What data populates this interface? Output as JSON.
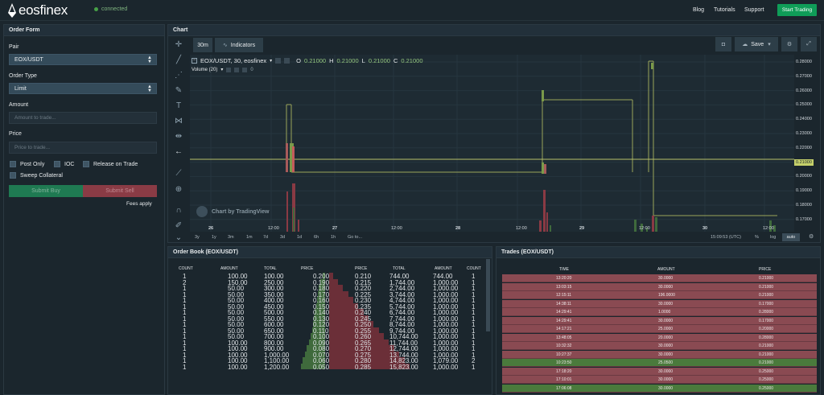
{
  "header": {
    "logo_text": "eosfinex",
    "status": "connected",
    "nav": [
      "Blog",
      "Tutorials",
      "Support"
    ],
    "cta": "Start Trading"
  },
  "order_form": {
    "title": "Order Form",
    "pair_label": "Pair",
    "pair_value": "EOX/USDT",
    "order_type_label": "Order Type",
    "order_type_value": "Limit",
    "amount_label": "Amount",
    "amount_placeholder": "Amount to trade...",
    "price_label": "Price",
    "price_placeholder": "Price to trade...",
    "post_only": "Post Only",
    "ioc": "IOC",
    "release": "Release on Trade",
    "sweep": "Sweep Collateral",
    "buy": "Submit Buy",
    "sell": "Submit Sell",
    "fees": "Fees apply"
  },
  "chart": {
    "title": "Chart",
    "interval": "30m",
    "indicators": "Indicators",
    "save": "Save",
    "symbol": "EOX/USDT, 30, eosfinex",
    "ohlc": {
      "O": "0.21000",
      "H": "0.21000",
      "L": "0.21000",
      "C": "0.21000"
    },
    "volume": "Volume (20)",
    "volume_value": "0",
    "watermark": "Chart by TradingView",
    "price_ticks": [
      "0.28000",
      "0.27000",
      "0.26000",
      "0.25000",
      "0.24000",
      "0.23000",
      "0.22000",
      "0.21000",
      "0.20000",
      "0.19000",
      "0.18000",
      "0.17000"
    ],
    "current_price": "0.21000",
    "time_ticks": [
      "26",
      "12:00",
      "27",
      "12:00",
      "28",
      "12:00",
      "29",
      "12:00",
      "30",
      "12:00"
    ],
    "ranges": [
      "3y",
      "1y",
      "3m",
      "1m",
      "7d",
      "3d",
      "1d",
      "6h",
      "1h",
      "Go to..."
    ],
    "clock": "15:09:53 (UTC)",
    "pct": "%",
    "log": "log",
    "auto": "auto"
  },
  "order_book": {
    "title": "Order Book (EOX/USDT)",
    "headers": [
      "COUNT",
      "AMOUNT",
      "TOTAL",
      "PRICE",
      "PRICE",
      "TOTAL",
      "AMOUNT",
      "COUNT"
    ],
    "bids": [
      [
        "1",
        "100.00",
        "100.00",
        "0.200"
      ],
      [
        "2",
        "150.00",
        "250.00",
        "0.190"
      ],
      [
        "1",
        "50.00",
        "300.00",
        "0.180"
      ],
      [
        "1",
        "50.00",
        "350.00",
        "0.170"
      ],
      [
        "1",
        "50.00",
        "400.00",
        "0.160"
      ],
      [
        "1",
        "50.00",
        "450.00",
        "0.150"
      ],
      [
        "1",
        "50.00",
        "500.00",
        "0.140"
      ],
      [
        "1",
        "50.00",
        "550.00",
        "0.130"
      ],
      [
        "1",
        "50.00",
        "600.00",
        "0.120"
      ],
      [
        "1",
        "50.00",
        "650.00",
        "0.110"
      ],
      [
        "1",
        "50.00",
        "700.00",
        "0.100"
      ],
      [
        "1",
        "100.00",
        "800.00",
        "0.090"
      ],
      [
        "1",
        "100.00",
        "900.00",
        "0.080"
      ],
      [
        "1",
        "100.00",
        "1,000.00",
        "0.070"
      ],
      [
        "1",
        "100.00",
        "1,100.00",
        "0.060"
      ],
      [
        "1",
        "100.00",
        "1,200.00",
        "0.050"
      ]
    ],
    "asks": [
      [
        "0.210",
        "744.00",
        "744.00",
        "1"
      ],
      [
        "0.215",
        "1,744.00",
        "1,000.00",
        "1"
      ],
      [
        "0.220",
        "2,744.00",
        "1,000.00",
        "1"
      ],
      [
        "0.225",
        "3,744.00",
        "1,000.00",
        "1"
      ],
      [
        "0.230",
        "4,744.00",
        "1,000.00",
        "1"
      ],
      [
        "0.235",
        "5,744.00",
        "1,000.00",
        "1"
      ],
      [
        "0.240",
        "6,744.00",
        "1,000.00",
        "1"
      ],
      [
        "0.245",
        "7,744.00",
        "1,000.00",
        "1"
      ],
      [
        "0.250",
        "8,744.00",
        "1,000.00",
        "1"
      ],
      [
        "0.255",
        "9,744.00",
        "1,000.00",
        "1"
      ],
      [
        "0.260",
        "10,744.00",
        "1,000.00",
        "1"
      ],
      [
        "0.265",
        "11,744.00",
        "1,000.00",
        "1"
      ],
      [
        "0.270",
        "12,744.00",
        "1,000.00",
        "1"
      ],
      [
        "0.275",
        "13,744.00",
        "1,000.00",
        "1"
      ],
      [
        "0.280",
        "14,823.00",
        "1,079.00",
        "2"
      ],
      [
        "0.285",
        "15,823.00",
        "1,000.00",
        "1"
      ]
    ]
  },
  "trades": {
    "title": "Trades (EOX/USDT)",
    "headers": [
      "TIME",
      "AMOUNT",
      "PRICE"
    ],
    "rows": [
      {
        "time": "13:20:20",
        "amount": "30.0000",
        "price": "0.21000",
        "side": "sell"
      },
      {
        "time": "13:03:15",
        "amount": "30.0000",
        "price": "0.21000",
        "side": "sell"
      },
      {
        "time": "12:15:11",
        "amount": "196.0000",
        "price": "0.21000",
        "side": "sell"
      },
      {
        "time": "14:38:11",
        "amount": "30.0000",
        "price": "0.17000",
        "side": "sell"
      },
      {
        "time": "14:29:41",
        "amount": "1.0000",
        "price": "0.28000",
        "side": "sell"
      },
      {
        "time": "14:29:41",
        "amount": "30.0000",
        "price": "0.17000",
        "side": "sell"
      },
      {
        "time": "14:17:21",
        "amount": "25.0000",
        "price": "0.20000",
        "side": "sell"
      },
      {
        "time": "13:48:05",
        "amount": "20.0000",
        "price": "0.28000",
        "side": "sell"
      },
      {
        "time": "10:32:32",
        "amount": "30.0000",
        "price": "0.21000",
        "side": "sell"
      },
      {
        "time": "10:27:37",
        "amount": "30.0000",
        "price": "0.21000",
        "side": "sell"
      },
      {
        "time": "10:23:50",
        "amount": "25.0500",
        "price": "0.21000",
        "side": "buy"
      },
      {
        "time": "17:18:20",
        "amount": "30.0000",
        "price": "0.25000",
        "side": "sell"
      },
      {
        "time": "17:10:01",
        "amount": "30.0000",
        "price": "0.25000",
        "side": "sell"
      },
      {
        "time": "17:06:08",
        "amount": "30.0000",
        "price": "0.25000",
        "side": "buy"
      }
    ]
  }
}
